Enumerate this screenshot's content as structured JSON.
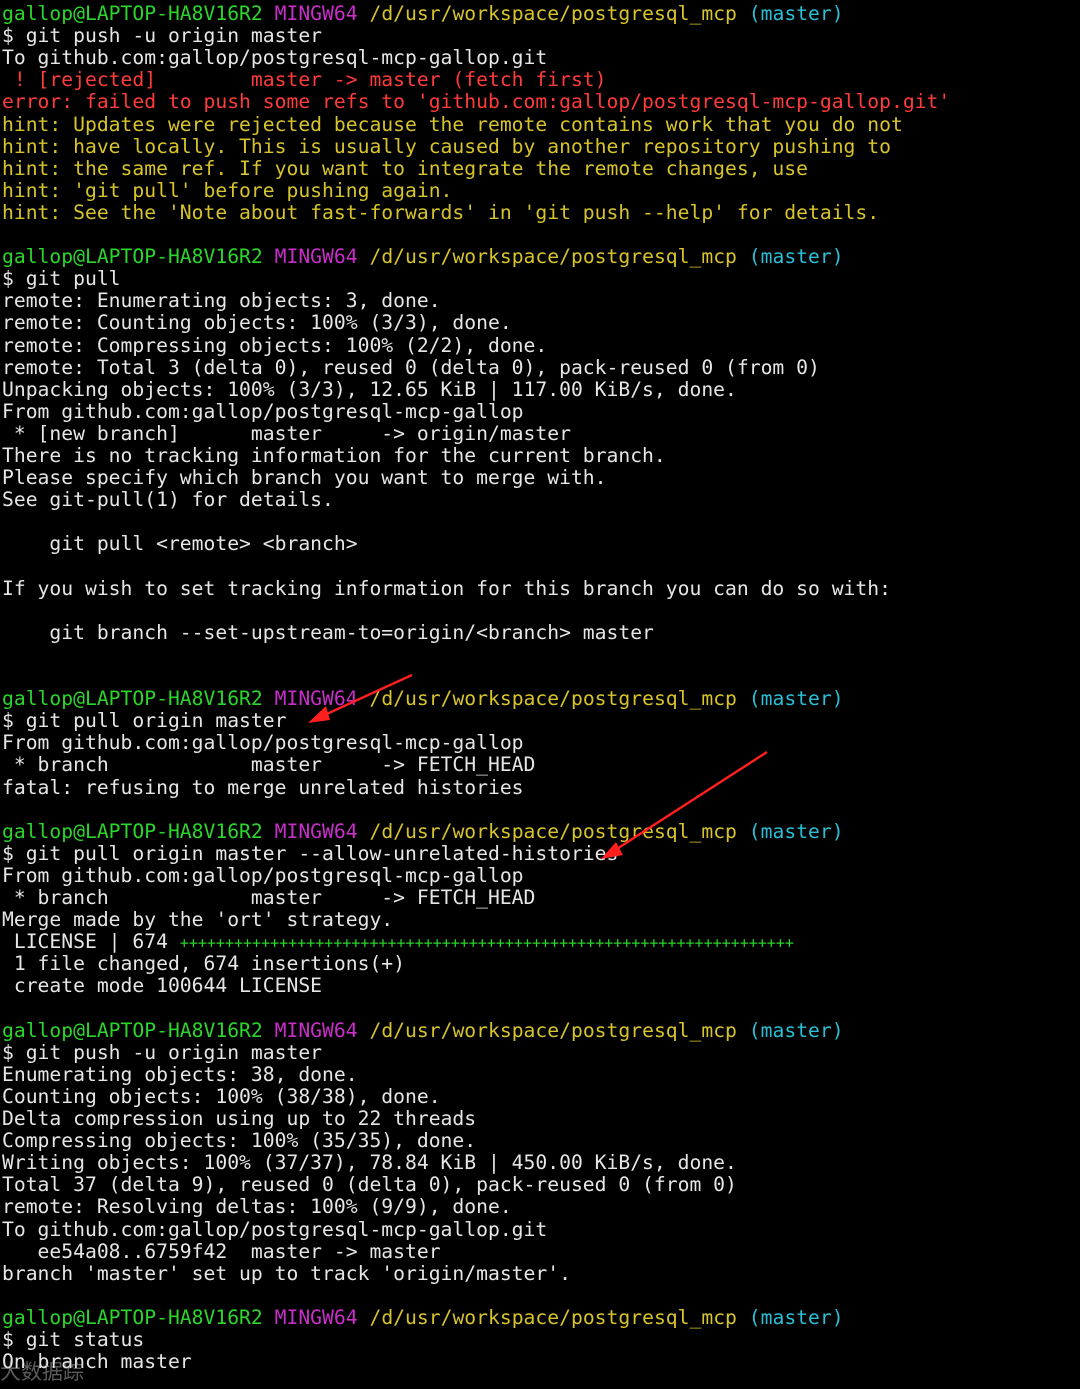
{
  "prompt": {
    "user": "gallop@LAPTOP-HA8V16R2",
    "shell": "MINGW64",
    "path": "/d/usr/workspace/postgresql_mcp",
    "branch": "(master)"
  },
  "watermark": "大数据踪",
  "blocks": [
    {
      "command": "$ git push -u origin master",
      "output": [
        {
          "t": "To github.com:gallop/postgresql-mcp-gallop.git",
          "c": "white"
        },
        {
          "t": " ! [rejected]        master -> master (fetch first)",
          "c": "rejected"
        },
        {
          "t": "error: failed to push some refs to 'github.com:gallop/postgresql-mcp-gallop.git'",
          "c": "red"
        },
        {
          "t": "hint: Updates were rejected because the remote contains work that you do not",
          "c": "hint"
        },
        {
          "t": "hint: have locally. This is usually caused by another repository pushing to",
          "c": "hint"
        },
        {
          "t": "hint: the same ref. If you want to integrate the remote changes, use",
          "c": "hint"
        },
        {
          "t": "hint: 'git pull' before pushing again.",
          "c": "hint"
        },
        {
          "t": "hint: See the 'Note about fast-forwards' in 'git push --help' for details.",
          "c": "hint"
        }
      ]
    },
    {
      "command": "$ git pull",
      "output": [
        {
          "t": "remote: Enumerating objects: 3, done.",
          "c": "white"
        },
        {
          "t": "remote: Counting objects: 100% (3/3), done.",
          "c": "white"
        },
        {
          "t": "remote: Compressing objects: 100% (2/2), done.",
          "c": "white"
        },
        {
          "t": "remote: Total 3 (delta 0), reused 0 (delta 0), pack-reused 0 (from 0)",
          "c": "white"
        },
        {
          "t": "Unpacking objects: 100% (3/3), 12.65 KiB | 117.00 KiB/s, done.",
          "c": "white"
        },
        {
          "t": "From github.com:gallop/postgresql-mcp-gallop",
          "c": "white"
        },
        {
          "t": " * [new branch]      master     -> origin/master",
          "c": "white"
        },
        {
          "t": "There is no tracking information for the current branch.",
          "c": "white"
        },
        {
          "t": "Please specify which branch you want to merge with.",
          "c": "white"
        },
        {
          "t": "See git-pull(1) for details.",
          "c": "white"
        },
        {
          "t": "",
          "c": "white"
        },
        {
          "t": "    git pull <remote> <branch>",
          "c": "white"
        },
        {
          "t": "",
          "c": "white"
        },
        {
          "t": "If you wish to set tracking information for this branch you can do so with:",
          "c": "white"
        },
        {
          "t": "",
          "c": "white"
        },
        {
          "t": "    git branch --set-upstream-to=origin/<branch> master",
          "c": "white"
        },
        {
          "t": "",
          "c": "white"
        }
      ]
    },
    {
      "command": "$ git pull origin master",
      "output": [
        {
          "t": "From github.com:gallop/postgresql-mcp-gallop",
          "c": "white"
        },
        {
          "t": " * branch            master     -> FETCH_HEAD",
          "c": "white"
        },
        {
          "t": "fatal: refusing to merge unrelated histories",
          "c": "white"
        }
      ]
    },
    {
      "command": "$ git pull origin master --allow-unrelated-histories",
      "output": [
        {
          "t": "From github.com:gallop/postgresql-mcp-gallop",
          "c": "white"
        },
        {
          "t": " * branch            master     -> FETCH_HEAD",
          "c": "white"
        },
        {
          "t": "Merge made by the 'ort' strategy.",
          "c": "white"
        },
        {
          "t": " LICENSE | 674 ",
          "c": "white",
          "plus": "++++++++++++++++++++++++++++++++++++++++++++++++++++++++++++++++++++"
        },
        {
          "t": " 1 file changed, 674 insertions(+)",
          "c": "white"
        },
        {
          "t": " create mode 100644 LICENSE",
          "c": "white"
        }
      ]
    },
    {
      "command": "$ git push -u origin master",
      "output": [
        {
          "t": "Enumerating objects: 38, done.",
          "c": "white"
        },
        {
          "t": "Counting objects: 100% (38/38), done.",
          "c": "white"
        },
        {
          "t": "Delta compression using up to 22 threads",
          "c": "white"
        },
        {
          "t": "Compressing objects: 100% (35/35), done.",
          "c": "white"
        },
        {
          "t": "Writing objects: 100% (37/37), 78.84 KiB | 450.00 KiB/s, done.",
          "c": "white"
        },
        {
          "t": "Total 37 (delta 9), reused 0 (delta 0), pack-reused 0 (from 0)",
          "c": "white"
        },
        {
          "t": "remote: Resolving deltas: 100% (9/9), done.",
          "c": "white"
        },
        {
          "t": "To github.com:gallop/postgresql-mcp-gallop.git",
          "c": "white"
        },
        {
          "t": "   ee54a08..6759f42  master -> master",
          "c": "white"
        },
        {
          "t": "branch 'master' set up to track 'origin/master'.",
          "c": "white"
        }
      ]
    },
    {
      "command": "$ git status",
      "output": [
        {
          "t": "On branch master",
          "c": "white"
        }
      ]
    }
  ]
}
